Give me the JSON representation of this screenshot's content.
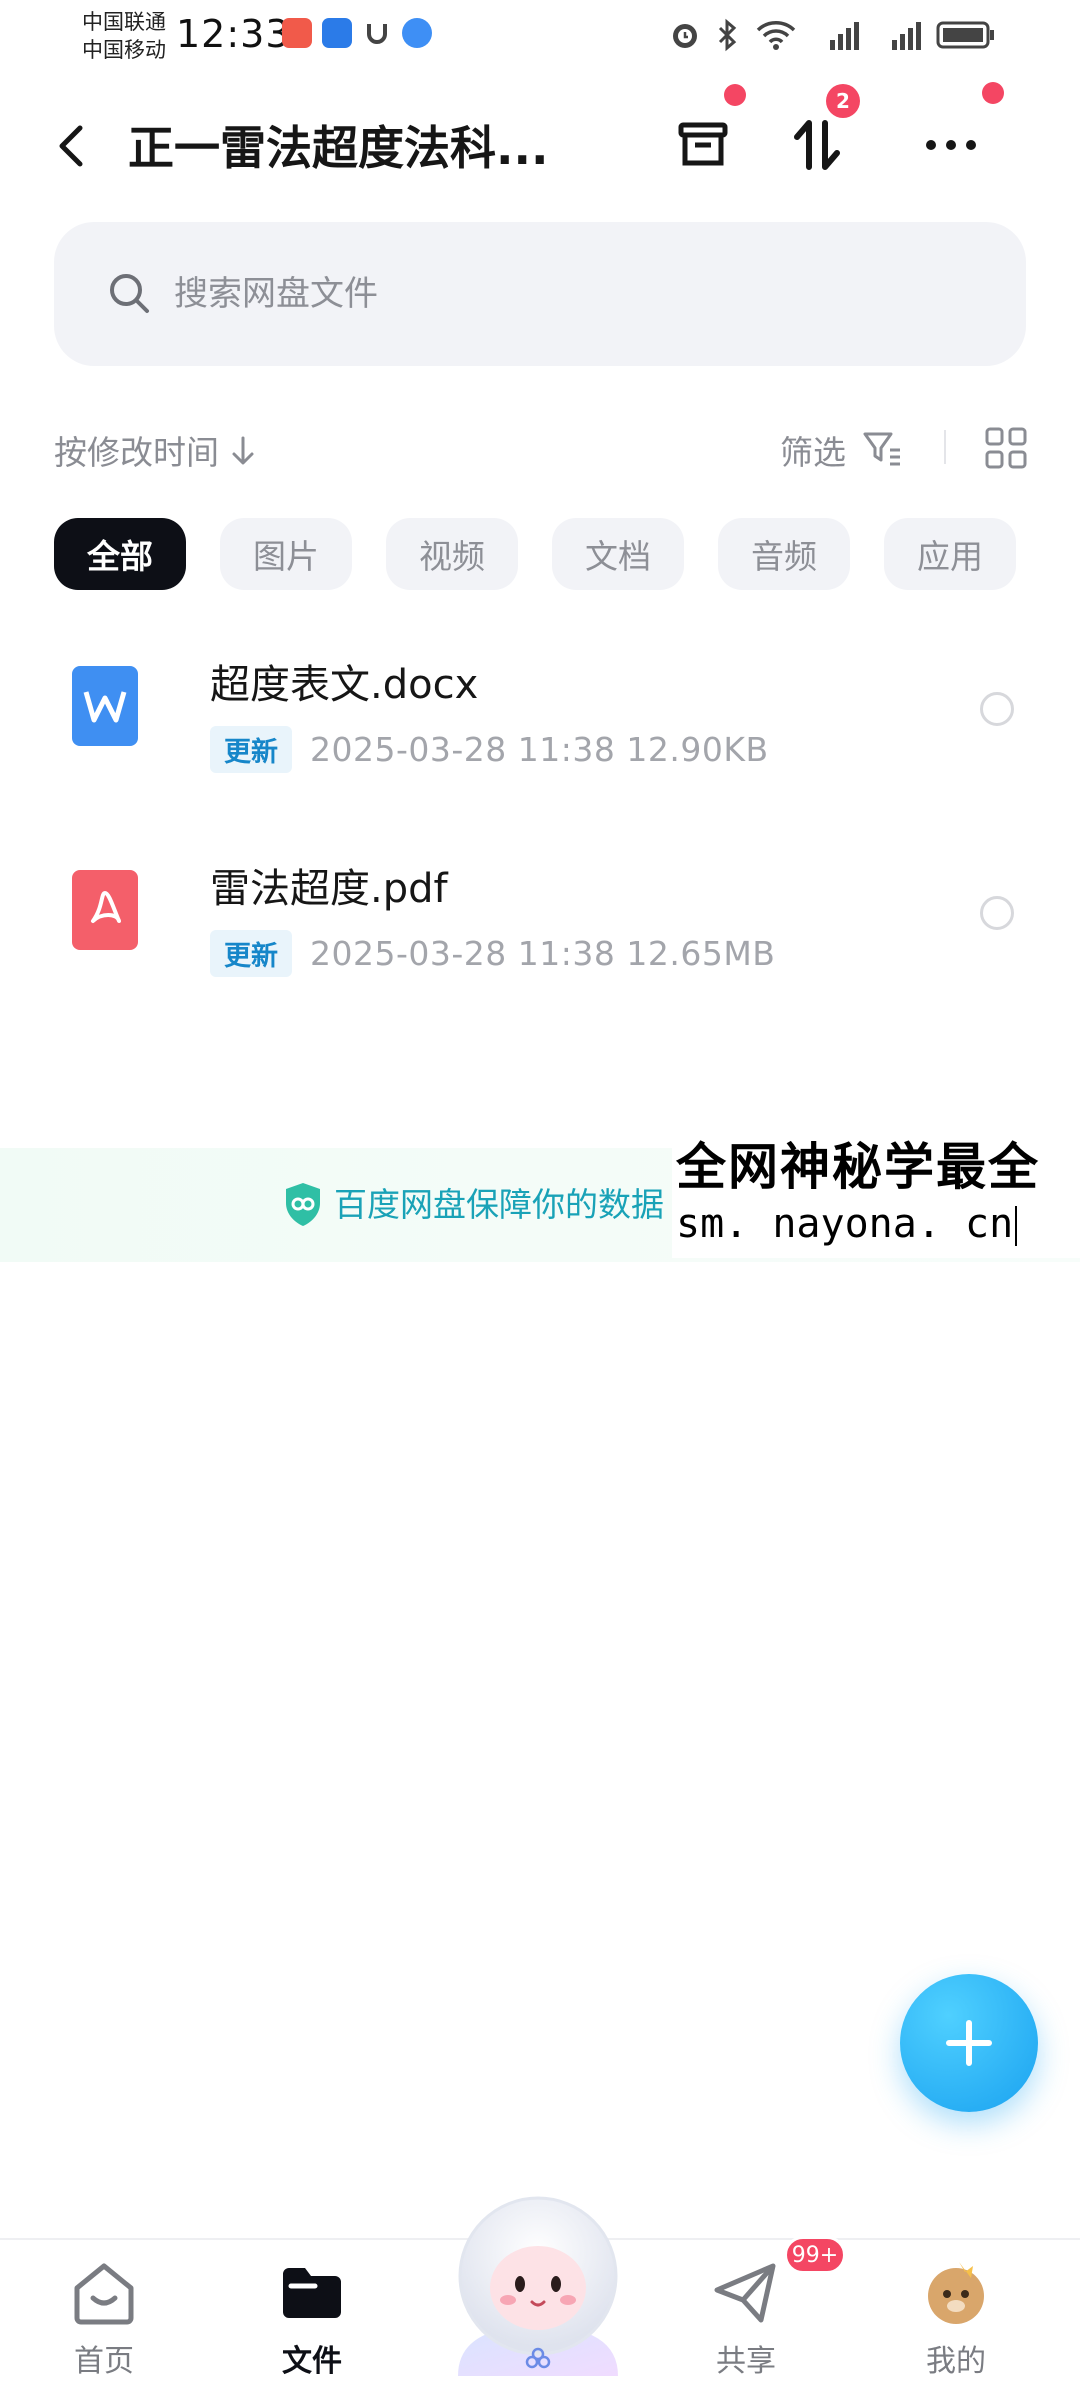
{
  "status_bar": {
    "carrier_1": "中国联通",
    "carrier_2": "中国移动",
    "time": "12:33"
  },
  "header": {
    "title": "正一雷法超度法科...",
    "transfer_badge": "2"
  },
  "search": {
    "placeholder": "搜索网盘文件"
  },
  "sort": {
    "label": "按修改时间",
    "filter_label": "筛选"
  },
  "tabs": [
    {
      "label": "全部",
      "active": true
    },
    {
      "label": "图片"
    },
    {
      "label": "视频"
    },
    {
      "label": "文档"
    },
    {
      "label": "音频"
    },
    {
      "label": "应用"
    }
  ],
  "files": [
    {
      "name": "超度表文.docx",
      "badge": "更新",
      "meta": "2025-03-28  11:38  12.90KB",
      "icon": "word-file-icon",
      "color": "#3f8ff2"
    },
    {
      "name": "雷法超度.pdf",
      "badge": "更新",
      "meta": "2025-03-28  11:38  12.65MB",
      "icon": "pdf-file-icon",
      "color": "#f45f6a"
    }
  ],
  "banner": {
    "text": "百度网盘保障你的数据"
  },
  "overlay": {
    "title": "全网神秘学最全",
    "url": "sm. nayona. cn"
  },
  "bottom_nav": {
    "home": "首页",
    "files": "文件",
    "share": "共享",
    "mine": "我的",
    "share_badge": "99+"
  },
  "colors": {
    "accent": "#1aa2f0",
    "badge_red": "#f44663",
    "active_tab": "#0d0f16"
  }
}
